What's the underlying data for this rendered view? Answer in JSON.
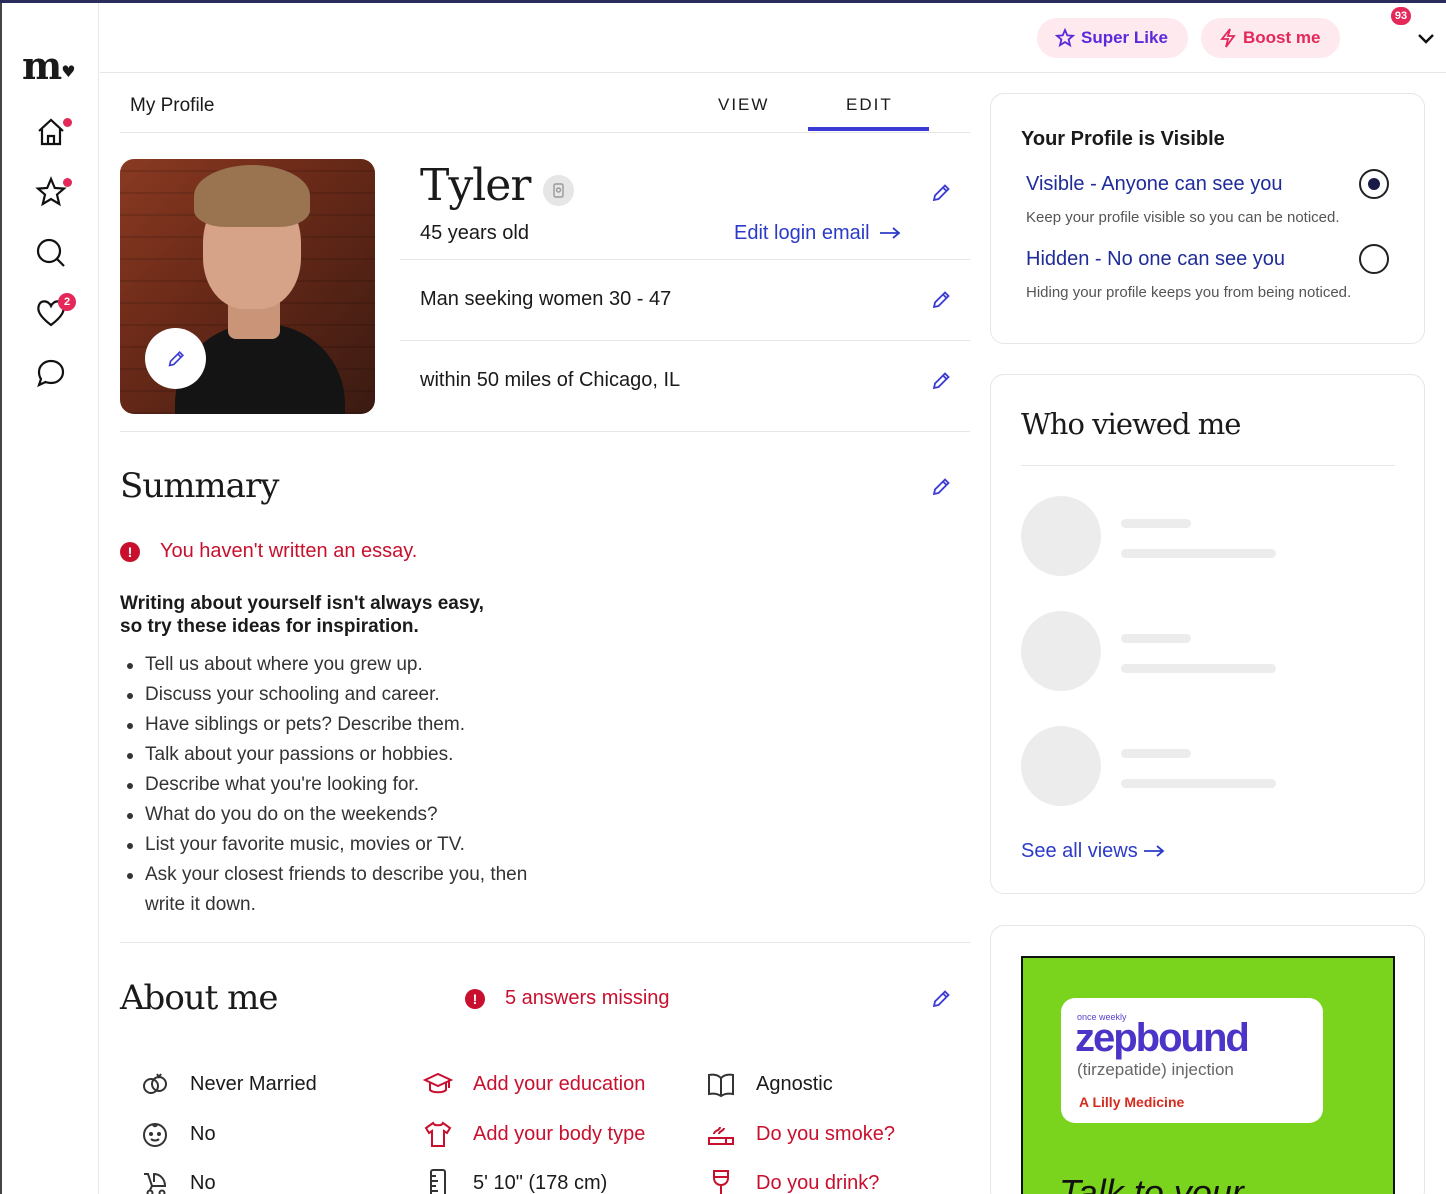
{
  "app": {
    "logo_text": "m",
    "logo_heart": "♥"
  },
  "header": {
    "super_like_label": "Super Like",
    "boost_label": "Boost me",
    "notification_count": "93"
  },
  "sidebar": {
    "items": [
      {
        "name": "home-icon"
      },
      {
        "name": "star-icon"
      },
      {
        "name": "search-icon"
      },
      {
        "name": "heart-icon",
        "badge": "2"
      },
      {
        "name": "chat-icon"
      }
    ]
  },
  "tabs": {
    "breadcrumb": "My Profile",
    "view": "VIEW",
    "edit": "EDIT",
    "active": "EDIT"
  },
  "profile": {
    "name": "Tyler",
    "age": "45 years old",
    "edit_email": "Edit login email",
    "seeking": "Man seeking women 30 - 47",
    "location": "within 50 miles of Chicago, IL"
  },
  "summary": {
    "title": "Summary",
    "alert": "You haven't written an essay.",
    "inspire_line1": "Writing about yourself isn't always easy,",
    "inspire_line2": "so try these ideas for inspiration.",
    "ideas": [
      "Tell us about where you grew up.",
      "Discuss your schooling and career.",
      "Have siblings or pets? Describe them.",
      "Talk about your passions or hobbies.",
      "Describe what you're looking for.",
      "What do you do on the weekends?",
      "List your favorite music, movies or TV.",
      "Ask your closest friends to describe you, then write it down."
    ]
  },
  "about": {
    "title": "About me",
    "alert": "5 answers missing",
    "items": [
      {
        "icon": "rings-icon",
        "text": "Never Married",
        "missing": false
      },
      {
        "icon": "graduation-cap-icon",
        "text": "Add your education",
        "missing": true
      },
      {
        "icon": "book-icon",
        "text": "Agnostic",
        "missing": false
      },
      {
        "icon": "baby-icon",
        "text": "No",
        "missing": false
      },
      {
        "icon": "shirt-icon",
        "text": "Add your body type",
        "missing": true
      },
      {
        "icon": "smoke-icon",
        "text": "Do you smoke?",
        "missing": true
      },
      {
        "icon": "stroller-icon",
        "text": "No",
        "missing": false
      },
      {
        "icon": "ruler-icon",
        "text": "5' 10\" (178 cm)",
        "missing": false
      },
      {
        "icon": "wine-glass-icon",
        "text": "Do you drink?",
        "missing": true
      }
    ]
  },
  "visibility": {
    "title": "Your Profile is Visible",
    "visible_label": "Visible - Anyone can see you",
    "visible_sub": "Keep your profile visible so you can be noticed.",
    "hidden_label": "Hidden - No one can see you",
    "hidden_sub": "Hiding your profile keeps you from being noticed.",
    "selected": "visible"
  },
  "who_viewed": {
    "title": "Who viewed me",
    "see_all": "See all views"
  },
  "ad": {
    "once": "once weekly",
    "brand": "zepbound",
    "generic": "(tirzepatide) injection",
    "maker": "A Lilly Medicine",
    "tagline": "Talk to your"
  },
  "colors": {
    "accent": "#2b3bc8",
    "alert": "#c8102e",
    "badge": "#e4285a",
    "ad_bg": "#7ad31c"
  }
}
